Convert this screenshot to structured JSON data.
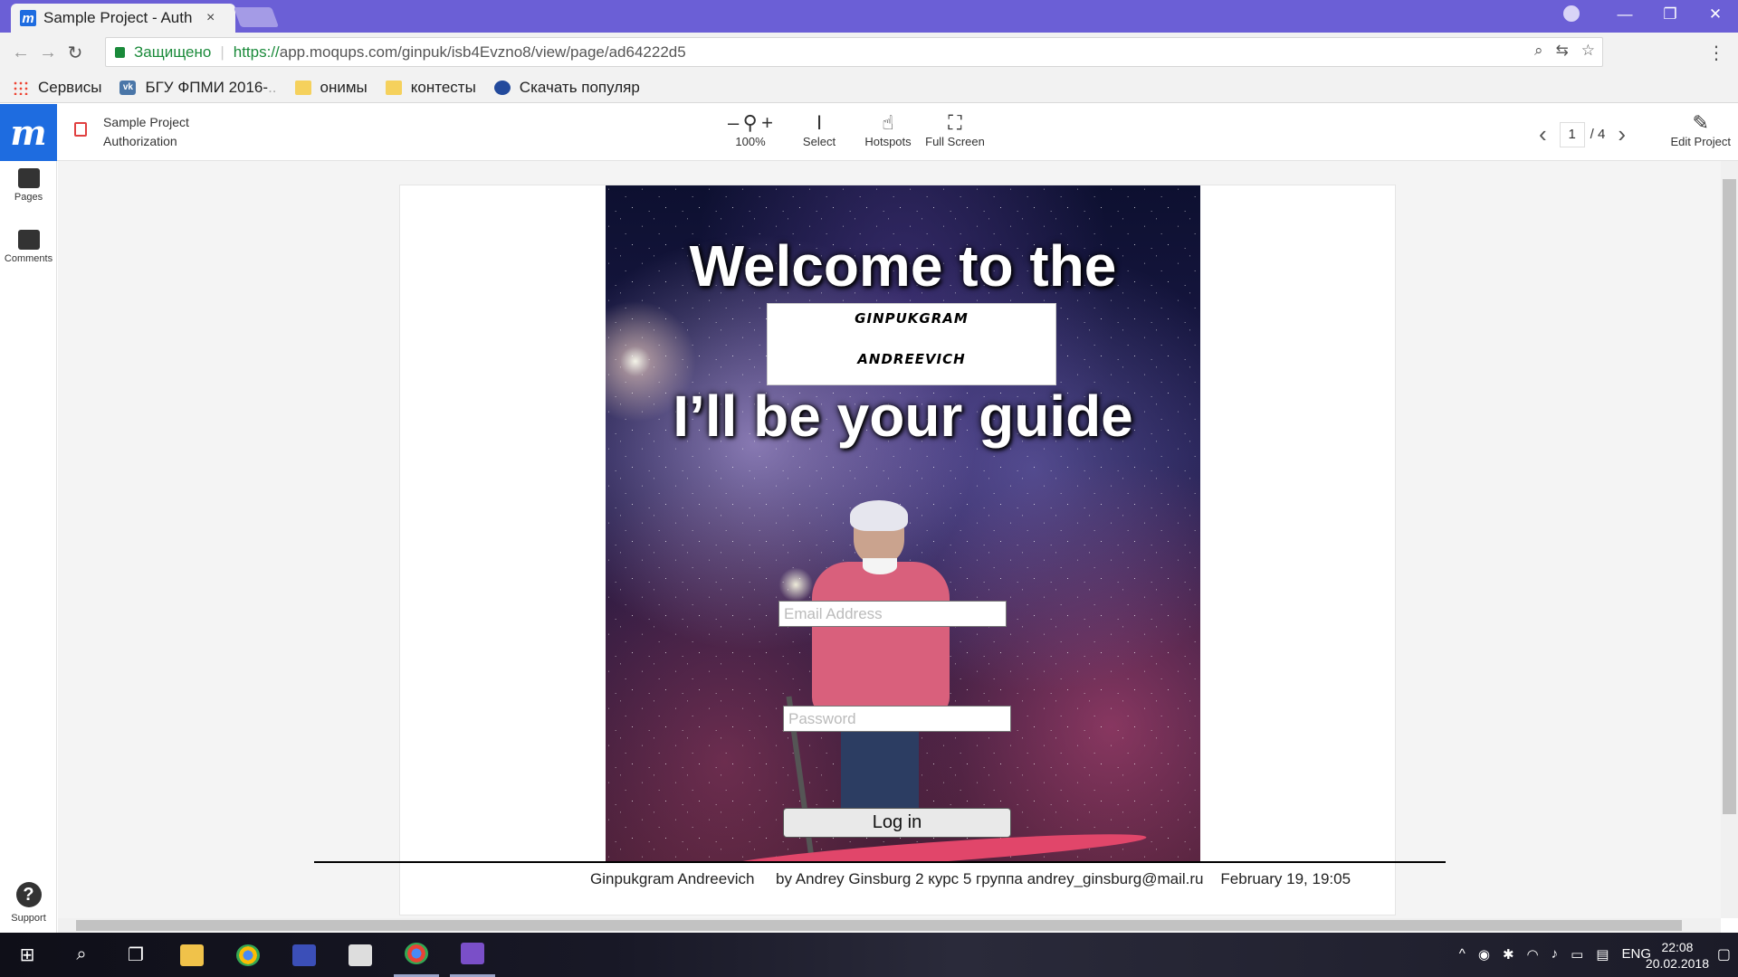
{
  "browser": {
    "tab_title": "Sample Project - Auth",
    "tab_close": "×",
    "secure_label": "Защищено",
    "url_scheme": "https://",
    "url_rest": "app.moqups.com/ginpuk/isb4Evzno8/view/page/ad64222d5",
    "bookmarks": [
      "Сервисы",
      "БГУ ФПМИ 2016-",
      "онимы",
      "контесты",
      "Скачать популяр"
    ]
  },
  "toolbar": {
    "logo": "m",
    "project_name": "Sample Project",
    "page_name": "Authorization",
    "zoom_label": "100%",
    "select_label": "Select",
    "hotspots_label": "Hotspots",
    "fullscreen_label": "Full Screen",
    "current_page": "1",
    "total_pages": "/ 4",
    "edit_label": "Edit Project"
  },
  "sidebar": {
    "pages_label": "Pages",
    "comments_label": "Comments",
    "support_label": "Support",
    "support_glyph": "?"
  },
  "mockup": {
    "welcome_text": "Welcome to the",
    "name_line1": "GINPUKGRAM",
    "name_line2": "ANDREEVICH",
    "guide_text": "I’ll be your guide",
    "email_placeholder": "Email Address",
    "password_placeholder": "Password",
    "login_label": "Log in",
    "footer": "Ginpukgram Andreevich     by Andrey Ginsburg 2 курс 5 группа andrey_ginsburg@mail.ru    February 19, 19:05"
  },
  "taskbar": {
    "language": "ENG",
    "time": "22:08",
    "date": "20.02.2018"
  },
  "colors": {
    "browser_frame": "#6b5fd6",
    "moqups_blue": "#1e6ce0",
    "secure_green": "#1a8a3a",
    "lock_red": "#e04040"
  },
  "icons": [
    "apps-icon",
    "vk-icon",
    "folder-icon",
    "globe-icon",
    "zoom-icon",
    "select-cursor-icon",
    "hand-icon",
    "fullscreen-icon",
    "pencil-icon",
    "pages-icon",
    "comments-icon",
    "help-icon"
  ]
}
